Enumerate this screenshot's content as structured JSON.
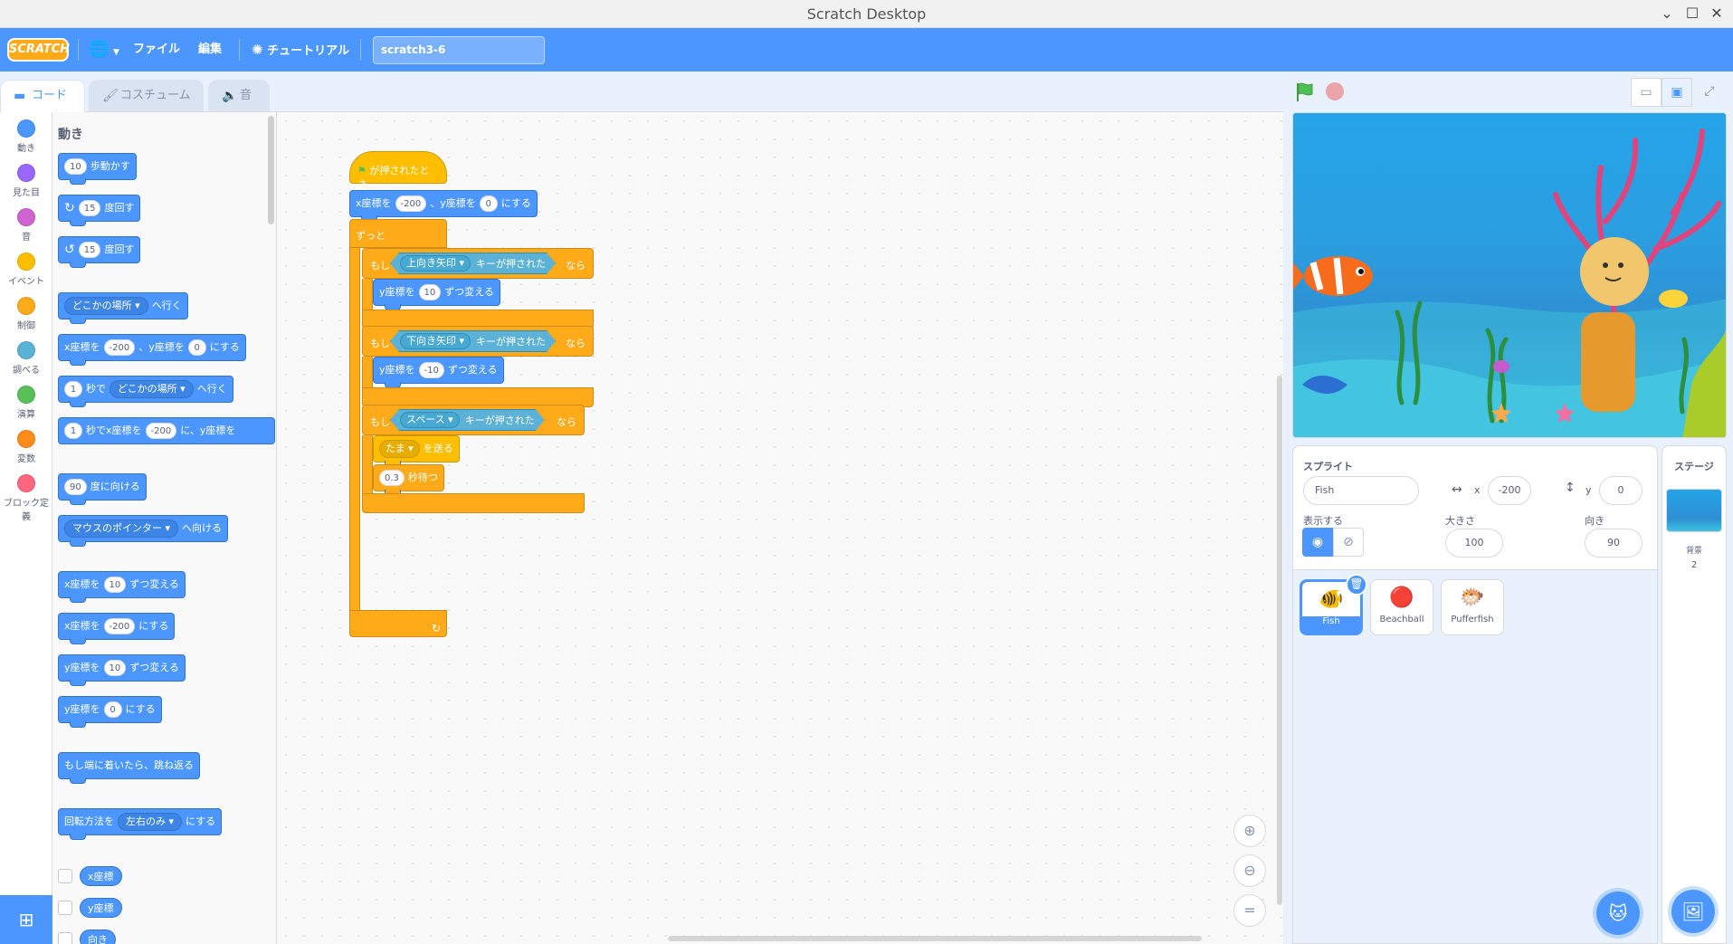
{
  "window": {
    "title": "Scratch Desktop"
  },
  "menu": {
    "logo": "SCRATCH",
    "file": "ファイル",
    "edit": "編集",
    "tutorials": "チュートリアル",
    "project_title": "scratch3-6"
  },
  "tabs": {
    "code": "コード",
    "costumes": "コスチューム",
    "sounds": "音"
  },
  "categories": [
    {
      "label": "動き",
      "color": "#4c97ff"
    },
    {
      "label": "見た目",
      "color": "#9966ff"
    },
    {
      "label": "音",
      "color": "#cf63cf"
    },
    {
      "label": "イベント",
      "color": "#ffbf00"
    },
    {
      "label": "制御",
      "color": "#ffab19"
    },
    {
      "label": "調べる",
      "color": "#5cb1d6"
    },
    {
      "label": "演算",
      "color": "#59c059"
    },
    {
      "label": "変数",
      "color": "#ff8c1a"
    },
    {
      "label": "ブロック定義",
      "color": "#ff6680"
    }
  ],
  "palette": {
    "title": "動き",
    "move": {
      "num": "10",
      "text": "歩動かす"
    },
    "turn_right": {
      "num": "15",
      "text": "度回す"
    },
    "turn_left": {
      "num": "15",
      "text": "度回す"
    },
    "goto": {
      "drop": "どこかの場所",
      "text": "へ行く"
    },
    "goto_xy": {
      "a": "x座標を",
      "x": "-200",
      "b": "、y座標を",
      "y": "0",
      "c": "にする"
    },
    "glide": {
      "num": "1",
      "a": "秒で",
      "drop": "どこかの場所",
      "b": "へ行く"
    },
    "glide_xy": {
      "num": "1",
      "a": "秒でx座標を",
      "x": "-200",
      "b": "に、y座標を"
    },
    "point_dir": {
      "num": "90",
      "text": "度に向ける"
    },
    "point_towards": {
      "drop": "マウスのポインター",
      "text": "へ向ける"
    },
    "change_x": {
      "a": "x座標を",
      "num": "10",
      "b": "ずつ変える"
    },
    "set_x": {
      "a": "x座標を",
      "num": "-200",
      "b": "にする"
    },
    "change_y": {
      "a": "y座標を",
      "num": "10",
      "b": "ずつ変える"
    },
    "set_y": {
      "a": "y座標を",
      "num": "0",
      "b": "にする"
    },
    "bounce": "もし端に着いたら、跳ね返る",
    "rotation": {
      "a": "回転方法を",
      "drop": "左右のみ",
      "b": "にする"
    },
    "rep_x": "x座標",
    "rep_y": "y座標",
    "rep_dir": "向き"
  },
  "script": {
    "hat": "が押されたとき",
    "goto": {
      "a": "x座標を",
      "x": "-200",
      "b": "、y座標を",
      "y": "0",
      "c": "にする"
    },
    "forever": "ずっと",
    "if1": {
      "if": "もし",
      "key": "上向き矢印",
      "pressed": "キーが押された",
      "then": "なら",
      "body_a": "y座標を",
      "body_num": "10",
      "body_b": "ずつ変える"
    },
    "if2": {
      "if": "もし",
      "key": "下向き矢印",
      "pressed": "キーが押された",
      "then": "なら",
      "body_a": "y座標を",
      "body_num": "-10",
      "body_b": "ずつ変える"
    },
    "if3": {
      "if": "もし",
      "key": "スペース",
      "pressed": "キーが押された",
      "then": "なら",
      "broadcast": "たま",
      "broadcast_text": "を送る",
      "wait_num": "0.3",
      "wait_text": "秒待つ"
    }
  },
  "sprite_info": {
    "sprite_label": "スプライト",
    "sprite_name": "Fish",
    "x_label": "x",
    "x_value": "-200",
    "y_label": "y",
    "y_value": "0",
    "show_label": "表示する",
    "size_label": "大きさ",
    "size_value": "100",
    "direction_label": "向き",
    "direction_value": "90"
  },
  "sprites": [
    {
      "name": "Fish",
      "icon": "🐠",
      "selected": true
    },
    {
      "name": "Beachball",
      "icon": "🔴"
    },
    {
      "name": "Pufferfish",
      "icon": "🐡"
    }
  ],
  "stage_pane": {
    "title": "ステージ",
    "backdrops_label": "背景",
    "backdrops_count": "2"
  },
  "colors": {
    "motion": "#4c97ff",
    "events": "#ffbf00",
    "control": "#ffab19",
    "sensing": "#5cb1d6",
    "menubar": "#4c97ff"
  }
}
